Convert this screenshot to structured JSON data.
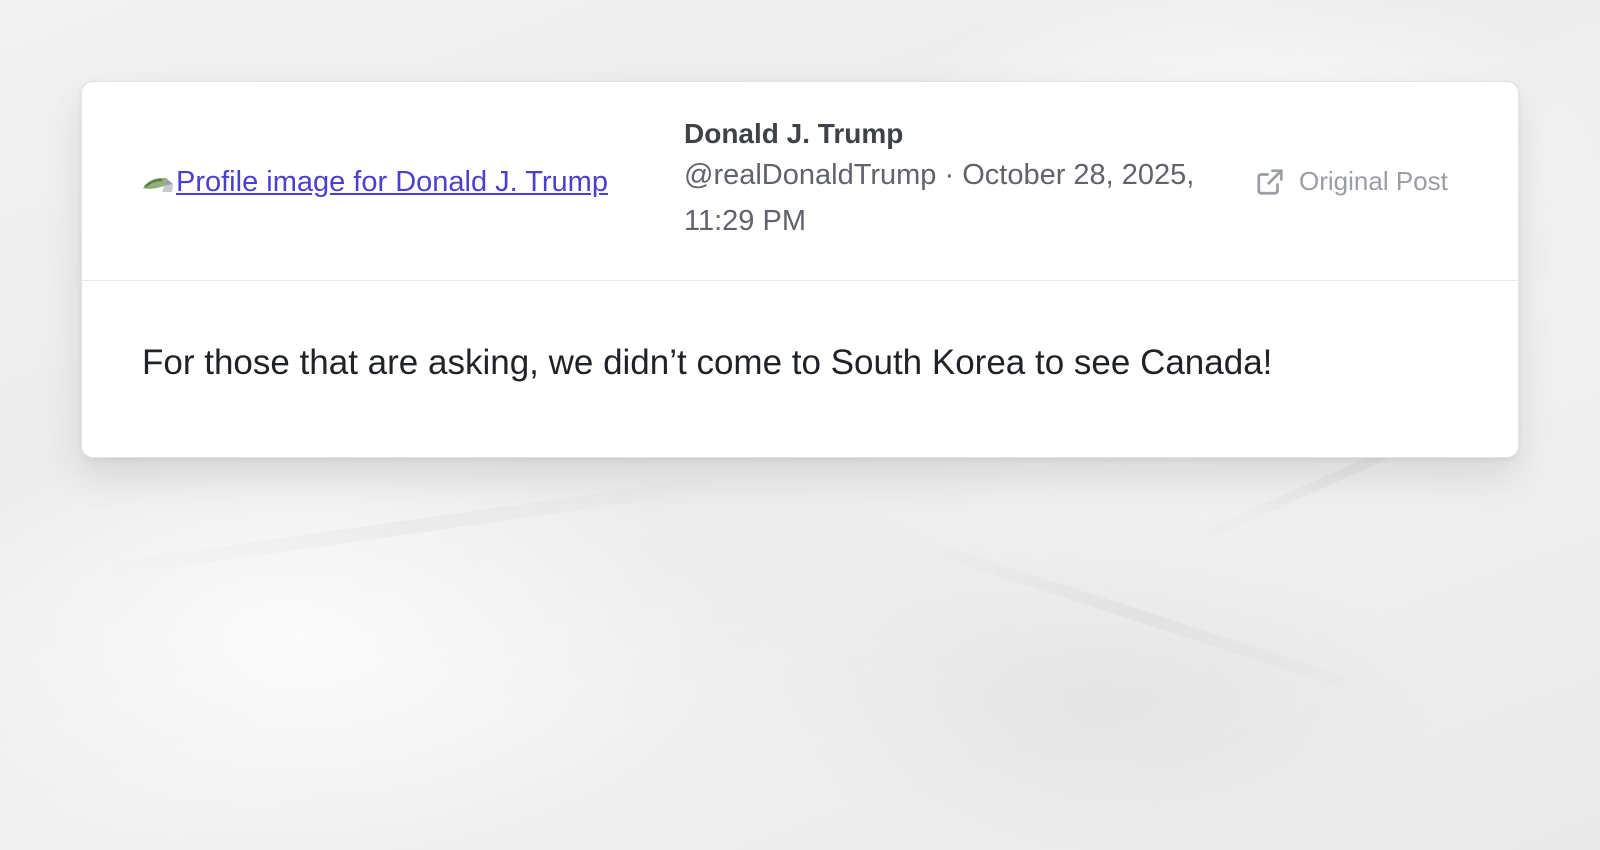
{
  "post": {
    "profile_image_alt": "Profile image for Donald J. Trump",
    "author_name": "Donald J. Trump",
    "handle": "@realDonaldTrump",
    "separator": "·",
    "date": "October 28, 2025,",
    "time": "11:29 PM",
    "original_post_label": "Original Post",
    "body_text": "For those that are asking, we didn’t come to South Korea to see Canada!"
  },
  "icons": {
    "broken_image": "broken-image-icon",
    "external_link": "external-link-icon"
  },
  "colors": {
    "link": "#4b3fd1",
    "author_name": "#3f4246",
    "meta_text": "#60646a",
    "original_post": "#9a9ea3",
    "body_text": "#1f2226"
  }
}
